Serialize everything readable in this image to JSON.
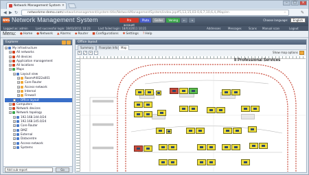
{
  "browser": {
    "tab_title": "Network Management System",
    "url_host": "networkme-demo.com",
    "url_path": "/networkmanagement/system-title/NetworkManagementSystem/index.jsp#5,13,15,03-0,6,7,10,6,4,/Map/en"
  },
  "app": {
    "title": "Network Management System",
    "logo_text": "NMS",
    "badges": [
      {
        "label": "Pro account",
        "color": "#d23a2a"
      },
      {
        "label": "Pluto",
        "color": "#4b5fd0"
      },
      {
        "label": "Gallos",
        "color": "#8c949c"
      },
      {
        "label": "Vening",
        "color": "#3aa54a"
      },
      {
        "label": "←",
        "color": "#6d7d90"
      },
      {
        "label": "→",
        "color": "#6d7d90"
      }
    ],
    "language_label": "Choose language:",
    "language_value": "English",
    "logged_as": "Logged as: admin",
    "last_successful": "Last successful login: 18/03/2011 10:23",
    "last_failed": "Last failed login: 18/03/2011 10:21",
    "right_links": [
      "Addresses",
      "Messages",
      "Scans",
      "Manual scan",
      "Logout"
    ]
  },
  "toolbar": {
    "menu_label": "Menu:",
    "items": [
      "Home",
      "Network",
      "Alarms",
      "Router",
      "Configurations",
      "Settings",
      "Help"
    ]
  },
  "left_panel": {
    "title": "Explorer",
    "tree": [
      {
        "label": "My infrastructure",
        "level": 0,
        "color": "#4a7ac8"
      },
      {
        "label": "All networks",
        "level": 1,
        "color": "#d3411f"
      },
      {
        "label": "All devices",
        "level": 1,
        "color": "#d3411f"
      },
      {
        "label": "Application management",
        "level": 1,
        "color": "#d3411f"
      },
      {
        "label": "All locations",
        "level": 1,
        "color": "#d3411f"
      },
      {
        "label": "Maps",
        "level": 1,
        "color": "#3aa54a"
      },
      {
        "label": "Layout view",
        "level": 2,
        "color": "#4a7ac8"
      },
      {
        "label": "Room#4022a001",
        "level": 3,
        "color": "#f0a93a"
      },
      {
        "label": "Core Router",
        "level": 3,
        "color": "#f0a93a"
      },
      {
        "label": "Access-network",
        "level": 3,
        "color": "#f0a93a"
      },
      {
        "label": "Internal",
        "level": 3,
        "color": "#f0a93a"
      },
      {
        "label": "Firewall",
        "level": 3,
        "color": "#f0a93a"
      },
      {
        "label": "Office layout",
        "level": 2,
        "color": "#4a7ac8",
        "selected": true
      },
      {
        "label": "Computers",
        "level": 1,
        "color": "#d3411f"
      },
      {
        "label": "Network devices",
        "level": 1,
        "color": "#d3411f"
      },
      {
        "label": "Network topology",
        "level": 1,
        "color": "#3aa54a"
      },
      {
        "label": "192.168.144.0/24",
        "level": 2,
        "color": "#4a7ac8"
      },
      {
        "label": "192.168.145.0/24",
        "level": 2,
        "color": "#4a7ac8"
      },
      {
        "label": "Core Router",
        "level": 2,
        "color": "#4a7ac8"
      },
      {
        "label": "DMZ",
        "level": 2,
        "color": "#4a7ac8"
      },
      {
        "label": "External",
        "level": 2,
        "color": "#4a7ac8"
      },
      {
        "label": "Datacentre",
        "level": 2,
        "color": "#4a7ac8"
      },
      {
        "label": "Access-network",
        "level": 2,
        "color": "#4a7ac8"
      },
      {
        "label": "Systems",
        "level": 2,
        "color": "#4a7ac8"
      }
    ],
    "footer_select": "Add sub-report",
    "footer_button": "Go"
  },
  "right_panel": {
    "title": "Office layout",
    "tabs": [
      "Summary",
      "Floorplan Info",
      "Map"
    ],
    "active_tab": "Map",
    "map_options": "Show map options",
    "floorplan_title": "II Professional Services"
  }
}
